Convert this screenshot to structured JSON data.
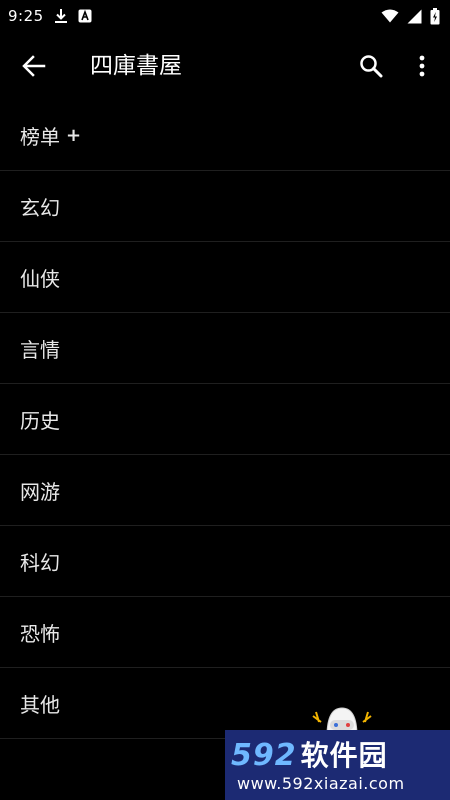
{
  "status_bar": {
    "time": "9:25",
    "icons": [
      "download-icon",
      "a-notification-icon",
      "wifi-icon",
      "signal-icon",
      "battery-icon"
    ]
  },
  "app_bar": {
    "title": "四庫書屋",
    "back_icon": "arrow-back-icon",
    "search_icon": "search-icon",
    "more_icon": "more-vert-icon"
  },
  "categories": [
    {
      "label": "榜单",
      "suffix": "+"
    },
    {
      "label": "玄幻"
    },
    {
      "label": "仙侠"
    },
    {
      "label": "言情"
    },
    {
      "label": "历史"
    },
    {
      "label": "网游"
    },
    {
      "label": "科幻"
    },
    {
      "label": "恐怖"
    },
    {
      "label": "其他"
    }
  ],
  "watermark": {
    "brand_number": "592",
    "brand_text": "软件园",
    "url": "www.592xiazai.com"
  },
  "colors": {
    "background": "#000000",
    "text": "#e8e8e8",
    "divider": "#1f1f1f",
    "watermark_bg": "#1c2a73",
    "watermark_accent": "#6fb8ff"
  }
}
